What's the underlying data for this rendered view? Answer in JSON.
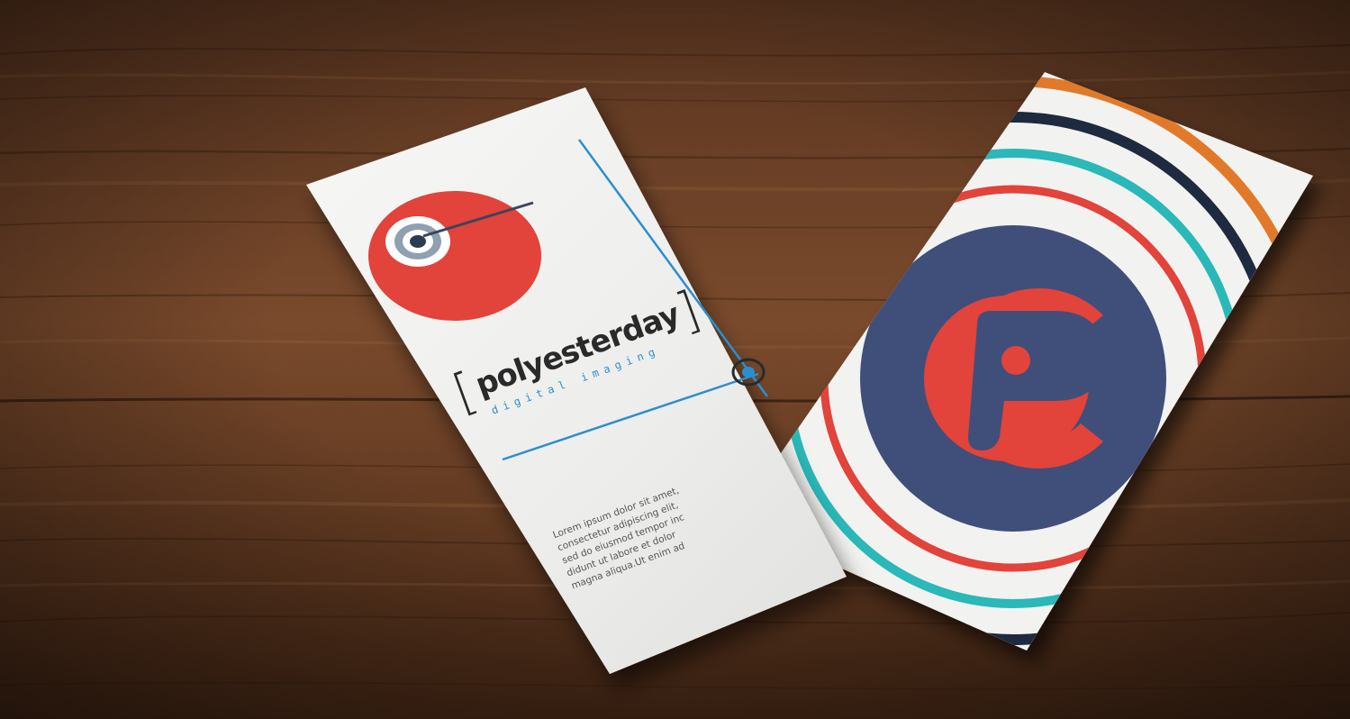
{
  "photo": {
    "subject": "business-card-mockup",
    "colors": {
      "wood_dark": "#3e2414",
      "wood_mid": "#6b4128",
      "wood_light": "#8a5a3a",
      "card_white": "#f2f2f0",
      "logo_red": "#e2433a",
      "logo_blue": "#2a8fd0",
      "navy": "#3f4f7a",
      "orange": "#e07a2a",
      "teal": "#2ab8b8",
      "dark_navy": "#1d2a3f"
    }
  },
  "front_card": {
    "brand_name": "polyesterday",
    "brand_tagline": "digital imaging",
    "bracket_left": "[",
    "bracket_right": "]",
    "body_lines": [
      "Lorem ipsum dolor sit amet,",
      "consectetur adipiscing elit,",
      "sed do eiusmod tempor inc",
      "didunt ut labore et dolor",
      "magna aliqua.Ut enim ad"
    ]
  },
  "back_card": {
    "monogram": "pc-monogram-logo"
  }
}
